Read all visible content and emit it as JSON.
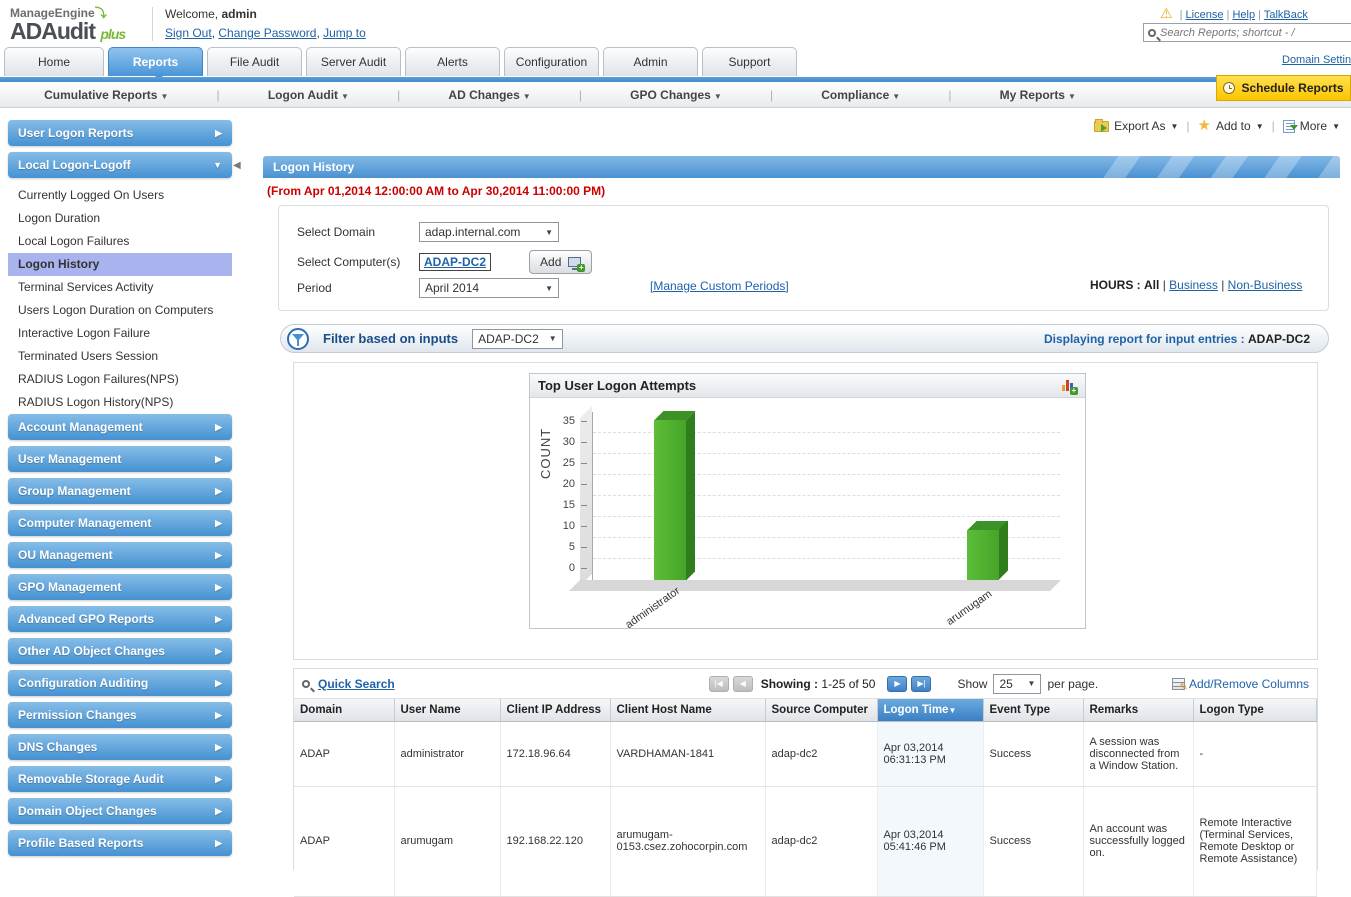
{
  "header": {
    "brand": {
      "manage": "ManageEngine",
      "product": "ADAudit",
      "plus": "plus"
    },
    "welcome_prefix": "Welcome,",
    "welcome_user": "admin",
    "sign_out": "Sign Out",
    "change_password": "Change Password",
    "jump_to": "Jump to",
    "utility_links": {
      "license": "License",
      "help": "Help",
      "talkback": "TalkBack"
    },
    "search_placeholder": "Search Reports; shortcut - /",
    "domain_settings": "Domain Settings"
  },
  "tabs": [
    "Home",
    "Reports",
    "File Audit",
    "Server Audit",
    "Alerts",
    "Configuration",
    "Admin",
    "Support"
  ],
  "active_tab": "Reports",
  "subnav": {
    "items": [
      "Cumulative Reports",
      "Logon Audit",
      "AD Changes",
      "GPO Changes",
      "Compliance",
      "My Reports"
    ],
    "schedule_reports": "Schedule Reports"
  },
  "sidebar": {
    "section_top": "User Logon Reports",
    "expanded_section": "Local Logon-Logoff",
    "expanded_items": [
      "Currently Logged On Users",
      "Logon Duration",
      "Local Logon Failures",
      "Logon History",
      "Terminal Services Activity",
      "Users Logon Duration on Computers",
      "Interactive Logon Failure",
      "Terminated Users Session",
      "RADIUS Logon Failures(NPS)",
      "RADIUS Logon History(NPS)"
    ],
    "selected_item": "Logon History",
    "sections": [
      "Account Management",
      "User Management",
      "Group Management",
      "Computer Management",
      "OU Management",
      "GPO Management",
      "Advanced GPO Reports",
      "Other AD Object Changes",
      "Configuration Auditing",
      "Permission Changes",
      "DNS Changes",
      "Removable Storage Audit",
      "Domain Object Changes",
      "Profile Based Reports"
    ]
  },
  "toolbar": {
    "export_as": "Export As",
    "add_to": "Add to",
    "more": "More"
  },
  "report": {
    "title": "Logon History",
    "date_range": "(From Apr 01,2014 12:00:00 AM to Apr 30,2014 11:00:00 PM)",
    "form": {
      "select_domain_label": "Select Domain",
      "select_domain_value": "adap.internal.com",
      "select_computers_label": "Select Computer(s)",
      "select_computers_value": "ADAP-DC2",
      "add_button": "Add",
      "period_label": "Period",
      "period_value": "April 2014",
      "manage_custom_periods": "[Manage Custom Periods]",
      "hours_label": "HOURS :",
      "hours_all": "All",
      "hours_business": "Business",
      "hours_non_business": "Non-Business"
    },
    "filter": {
      "label": "Filter based on inputs",
      "value": "ADAP-DC2",
      "displaying_label": "Displaying report for input entries :",
      "displaying_value": "ADAP-DC2"
    }
  },
  "chart_data": {
    "type": "bar",
    "title": "Top User Logon Attempts",
    "categories": [
      "administrator",
      "arumugam"
    ],
    "values": [
      38,
      12
    ],
    "xlabel": "",
    "ylabel": "COUNT",
    "ylim": [
      0,
      40
    ],
    "yticks": [
      35,
      30,
      25,
      20,
      15,
      10,
      5,
      0
    ],
    "grid": "dashed-horizontal",
    "legend_position": "none",
    "bar_color": "#4faf30"
  },
  "table": {
    "quick_search": "Quick Search",
    "pagination": {
      "showing_label": "Showing :",
      "range": "1-25 of 50",
      "show_label": "Show",
      "page_size": "25",
      "per_page": "per page."
    },
    "add_remove_columns": "Add/Remove Columns",
    "columns": [
      "Domain",
      "User Name",
      "Client IP Address",
      "Client Host Name",
      "Source Computer",
      "Logon Time",
      "Event Type",
      "Remarks",
      "Logon Type"
    ],
    "sorted_column": "Logon Time",
    "rows": [
      [
        "ADAP",
        "administrator",
        "172.18.96.64",
        "VARDHAMAN-1841",
        "adap-dc2",
        "Apr 03,2014 06:31:13 PM",
        "Success",
        "A session was disconnected from a Window Station.",
        "-"
      ],
      [
        "ADAP",
        "arumugam",
        "192.168.22.120",
        "arumugam-0153.csez.zohocorpin.com",
        "adap-dc2",
        "Apr 03,2014 05:41:46 PM",
        "Success",
        "An account was successfully logged on.",
        "Remote Interactive (Terminal Services, Remote Desktop or Remote Assistance)"
      ]
    ]
  },
  "colors": {
    "accent_blue": "#4a92d2",
    "selected_item": "#a9b3ee",
    "bar_green": "#4faf30",
    "alert_red": "#cc0000",
    "schedule_yellow": "#fcc500"
  }
}
